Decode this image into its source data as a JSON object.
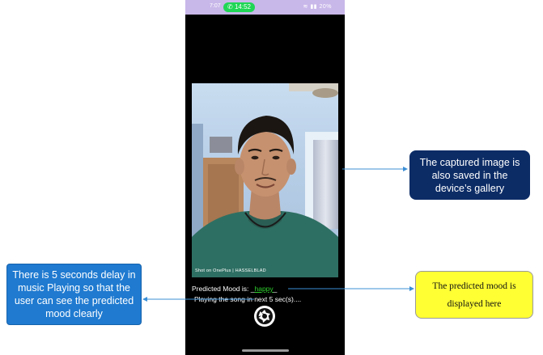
{
  "status_bar": {
    "time_left": "7:07",
    "call_time": "14:52",
    "battery": "20%"
  },
  "photo": {
    "watermark": "Shot on OnePlus | HASSELBLAD"
  },
  "app": {
    "mood_label": "Predicted Mood is: _",
    "mood_value": "happy",
    "mood_trailing": "_",
    "playing_text": "Playing the song in next 5 sec(s)...."
  },
  "annotations": {
    "left": "There is 5 seconds delay in music Playing so that the user can see the predicted mood clearly",
    "right_top": "The captured image is also saved in the device’s gallery",
    "right_bottom": "The predicted mood is displayed here"
  },
  "colors": {
    "status_bar_bg": "#c8b7e9",
    "call_pill": "#1fd655",
    "mood_value": "#2ed12e",
    "callout_left_bg": "#1f7ad0",
    "callout_right_top_bg": "#0c2c66",
    "callout_right_bottom_bg": "#ffff33",
    "arrow": "#3b8fd6"
  },
  "icons": {
    "shutter": "camera-shutter-icon"
  }
}
